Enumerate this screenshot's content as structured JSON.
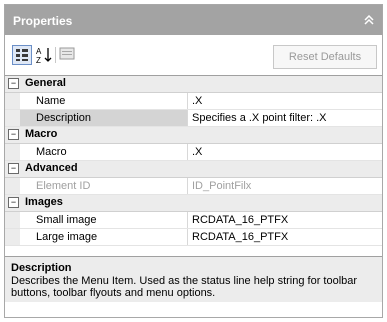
{
  "panel": {
    "title": "Properties",
    "collapse_icon": "double-chevron-up-icon"
  },
  "toolbar": {
    "categorized_icon": "categorized-view-icon",
    "alphabetical_icon": "sort-az-icon",
    "pages_icon": "property-pages-icon",
    "reset_label": "Reset Defaults"
  },
  "grid": {
    "categories": [
      {
        "label": "General",
        "expanded": true,
        "properties": [
          {
            "name": "Name",
            "value": ".X"
          },
          {
            "name": "Description",
            "value": "Specifies a .X point filter: .X",
            "selected": true
          }
        ]
      },
      {
        "label": "Macro",
        "expanded": true,
        "properties": [
          {
            "name": "Macro",
            "value": ".X"
          }
        ]
      },
      {
        "label": "Advanced",
        "expanded": true,
        "properties": [
          {
            "name": "Element ID",
            "value": "ID_PointFilx",
            "disabled": true
          }
        ]
      },
      {
        "label": "Images",
        "expanded": true,
        "properties": [
          {
            "name": "Small image",
            "value": "RCDATA_16_PTFX"
          },
          {
            "name": "Large image",
            "value": "RCDATA_16_PTFX"
          }
        ]
      }
    ],
    "toggle_symbol": "⊟"
  },
  "description": {
    "title": "Description",
    "text": "Describes the Menu Item. Used as the status line help string for toolbar buttons, toolbar flyouts and menu options."
  }
}
